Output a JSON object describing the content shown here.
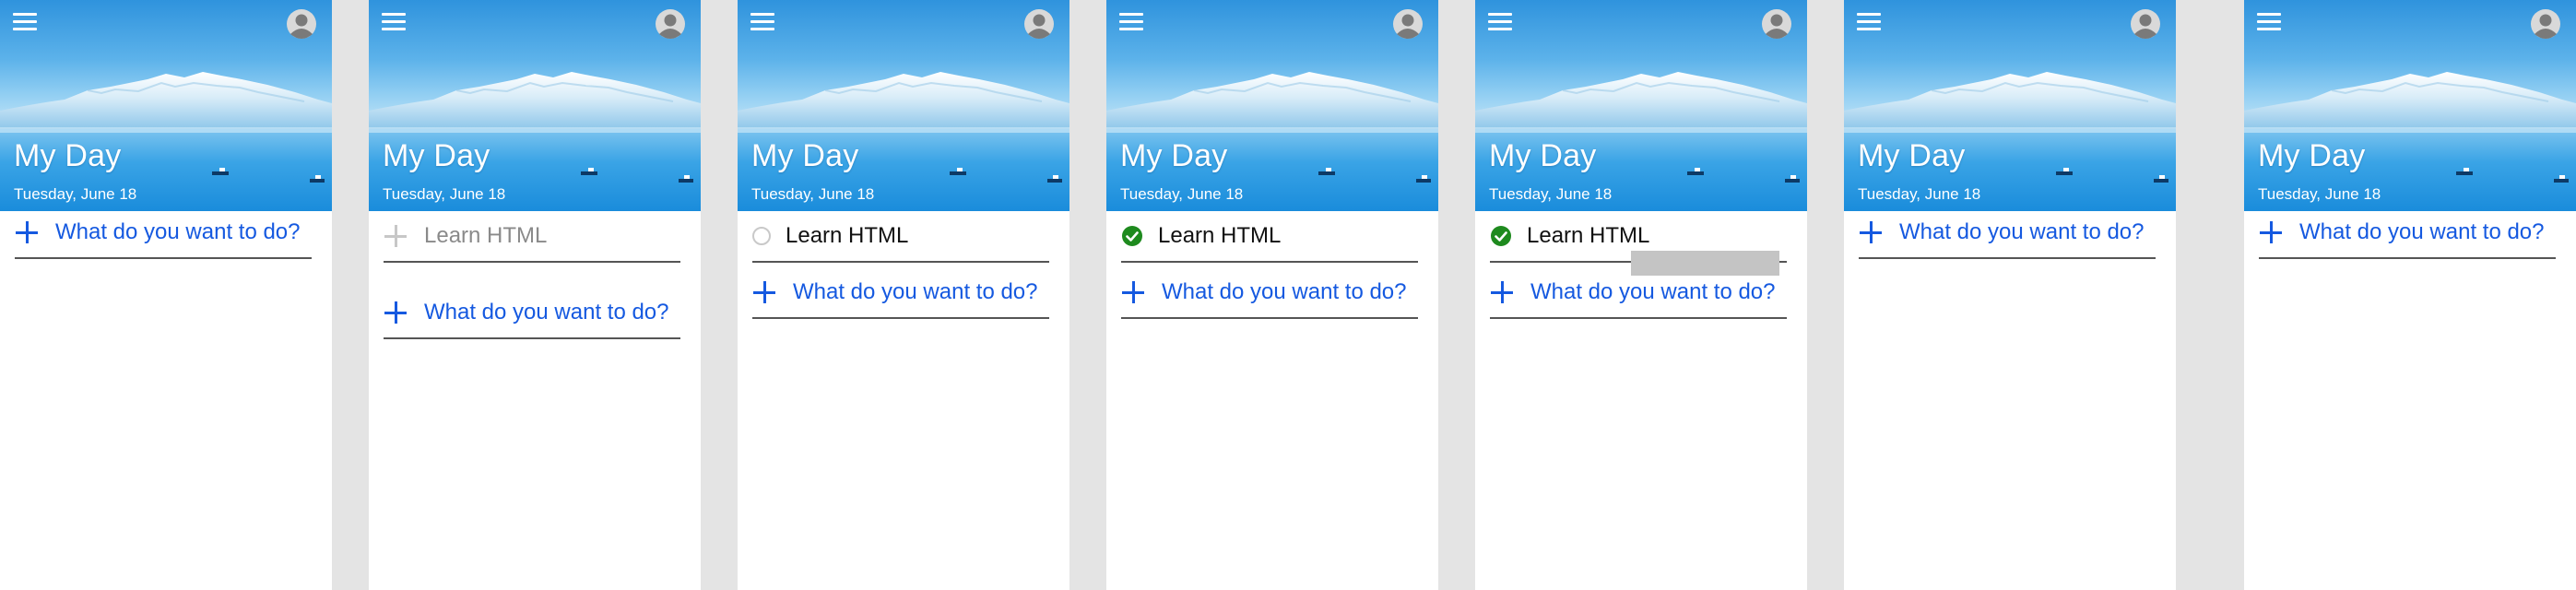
{
  "app": {
    "title": "My Day",
    "date": "Tuesday, June 18",
    "add_placeholder": "What do you want to do?",
    "task_name": "Learn HTML"
  },
  "colors": {
    "accent": "#1559e0",
    "check": "#1e8a1e",
    "panel_bg": "#ffffff",
    "page_bg": "#e4e4e4"
  },
  "icons": [
    "menu-icon",
    "account-icon",
    "plus-icon",
    "circle-icon",
    "check-circle-icon"
  ],
  "frames": [
    {
      "state": "empty"
    },
    {
      "state": "typing"
    },
    {
      "state": "task-added"
    },
    {
      "state": "task-completed"
    },
    {
      "state": "task-deleting"
    },
    {
      "state": "empty"
    },
    {
      "state": "empty"
    }
  ]
}
